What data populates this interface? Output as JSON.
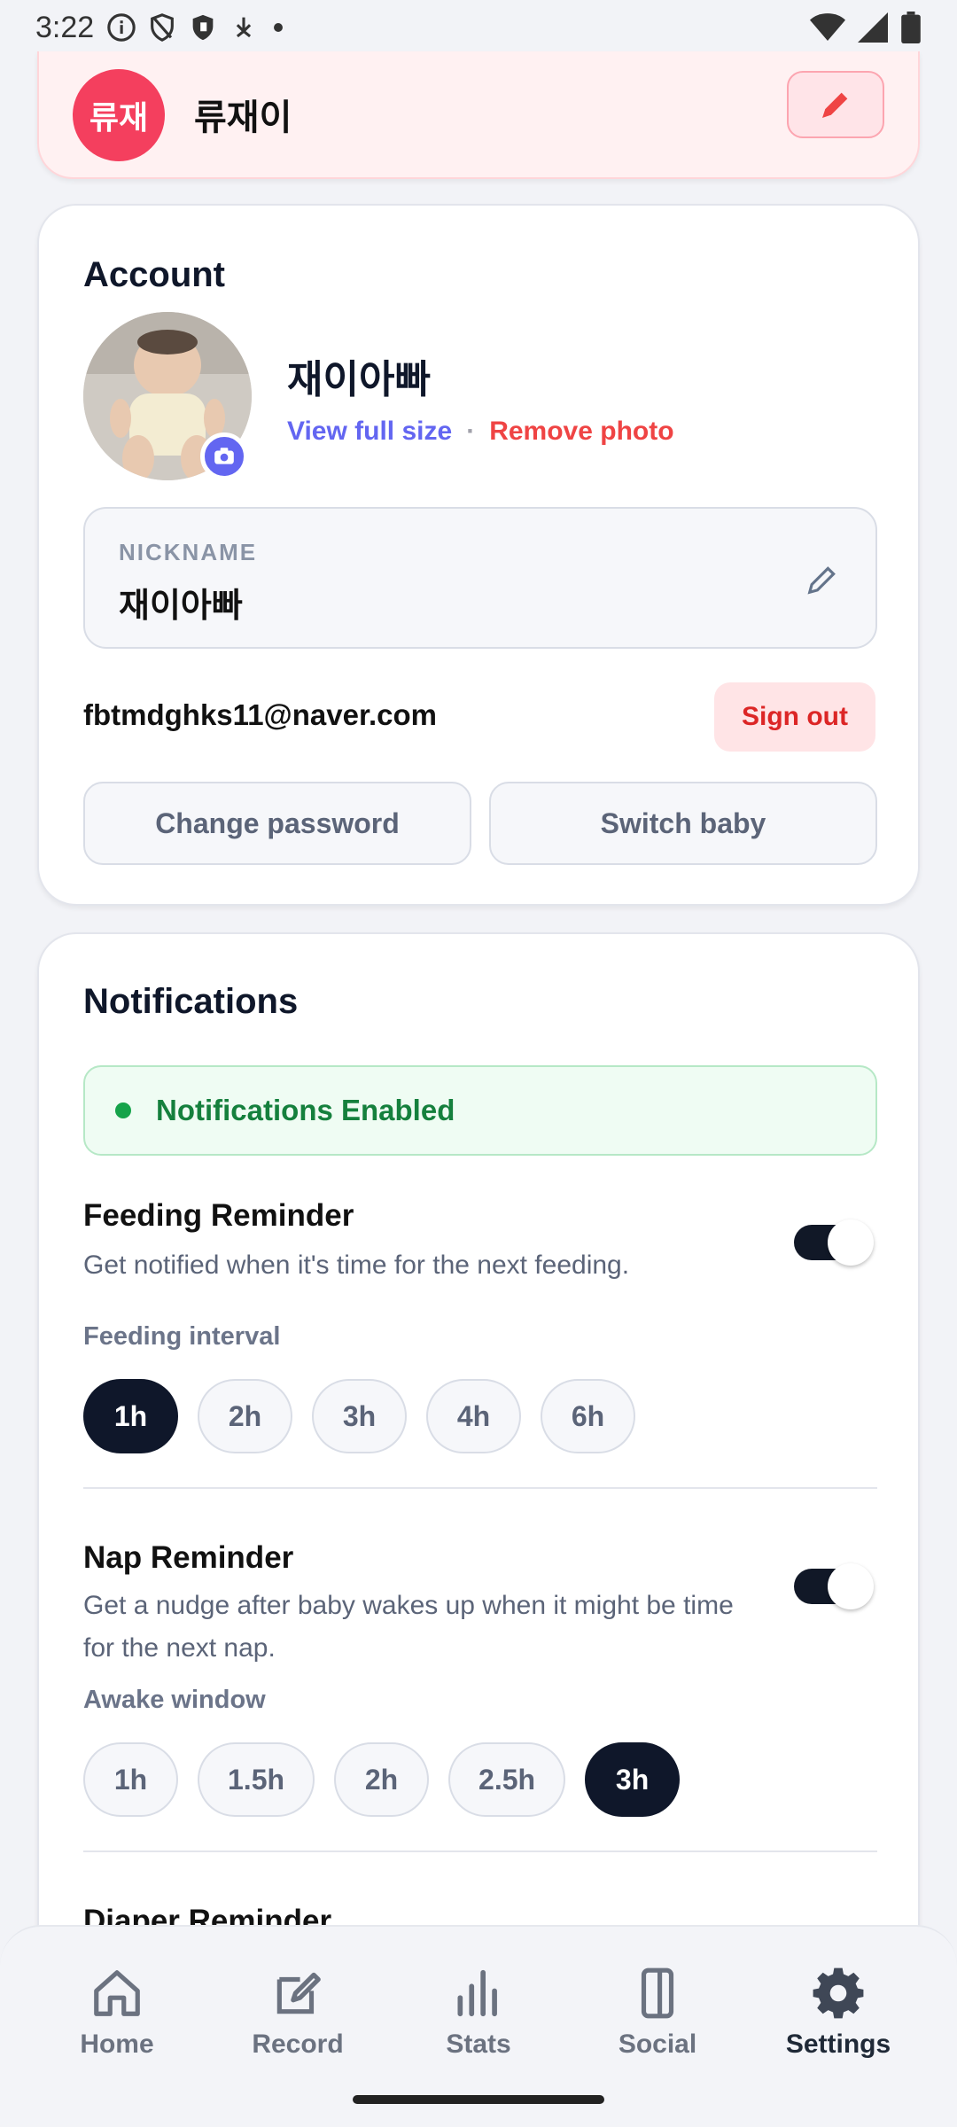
{
  "status_bar": {
    "time": "3:22"
  },
  "baby_card": {
    "avatar_text": "류재",
    "name": "류재이"
  },
  "account": {
    "title": "Account",
    "display_name": "재이아빠",
    "view_full_size": "View full size",
    "separator": "·",
    "remove_photo": "Remove photo",
    "nickname_label": "NICKNAME",
    "nickname_value": "재이아빠",
    "email": "fbtmdghks11@naver.com",
    "sign_out": "Sign out",
    "change_password": "Change password",
    "switch_baby": "Switch baby"
  },
  "notifications": {
    "title": "Notifications",
    "enabled_text": "Notifications Enabled",
    "feeding": {
      "title": "Feeding Reminder",
      "desc": "Get notified when it's time for the next feeding.",
      "enabled": true,
      "interval_label": "Feeding interval",
      "options": [
        "1h",
        "2h",
        "3h",
        "4h",
        "6h"
      ],
      "selected": "1h"
    },
    "nap": {
      "title": "Nap Reminder",
      "desc": "Get a nudge after baby wakes up when it might be time for the next nap.",
      "enabled": true,
      "window_label": "Awake window",
      "options": [
        "1h",
        "1.5h",
        "2h",
        "2.5h",
        "3h"
      ],
      "selected": "3h"
    },
    "diaper": {
      "title": "Diaper Reminder"
    }
  },
  "nav": {
    "items": [
      {
        "label": "Home",
        "icon": "home-icon"
      },
      {
        "label": "Record",
        "icon": "edit-icon"
      },
      {
        "label": "Stats",
        "icon": "bar-chart-icon"
      },
      {
        "label": "Social",
        "icon": "phone-icon"
      },
      {
        "label": "Settings",
        "icon": "gear-icon"
      }
    ],
    "active": "Settings"
  },
  "colors": {
    "accent_indigo": "#6366f1",
    "danger_red": "#ef4444",
    "success_green": "#15803d",
    "dark_navy": "#0f172a",
    "baby_pink": "#f43f5e"
  }
}
